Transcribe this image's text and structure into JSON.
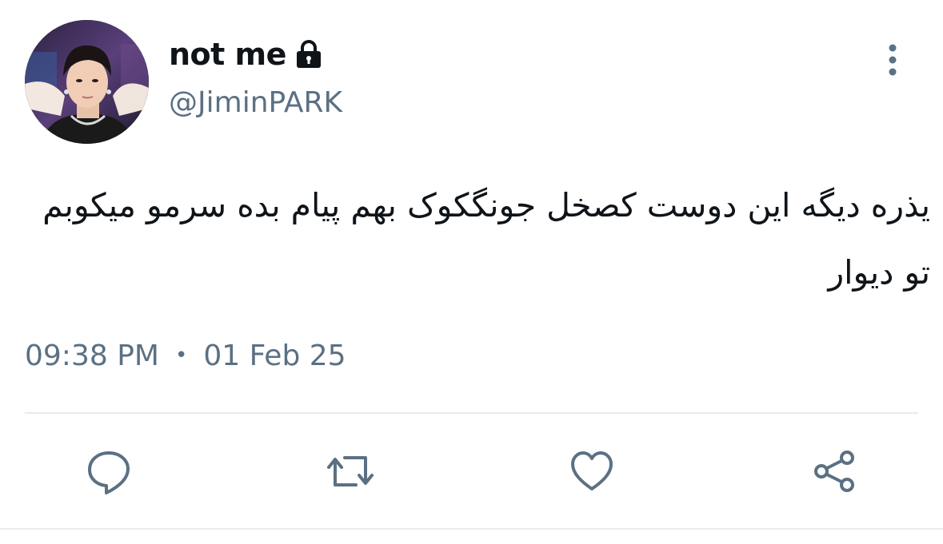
{
  "user": {
    "display_name": "not me",
    "handle": "@JiminPARK",
    "protected_icon": "lock-icon",
    "avatar": "profile-photo"
  },
  "tweet": {
    "text": "یذره دیگه این دوست کصخل جونگکوک بهم پیام بده سرمو میکوبم تو دیوار",
    "time": "09:38 PM",
    "separator": "•",
    "date": "01 Feb 25"
  },
  "actions": [
    {
      "name": "reply",
      "icon": "comment-icon"
    },
    {
      "name": "retweet",
      "icon": "retweet-icon"
    },
    {
      "name": "like",
      "icon": "heart-icon"
    },
    {
      "name": "share",
      "icon": "share-icon"
    }
  ],
  "colors": {
    "text_primary": "#0f1419",
    "text_secondary": "#5b7083",
    "divider": "#e6ecf0",
    "icon": "#5b7083"
  }
}
